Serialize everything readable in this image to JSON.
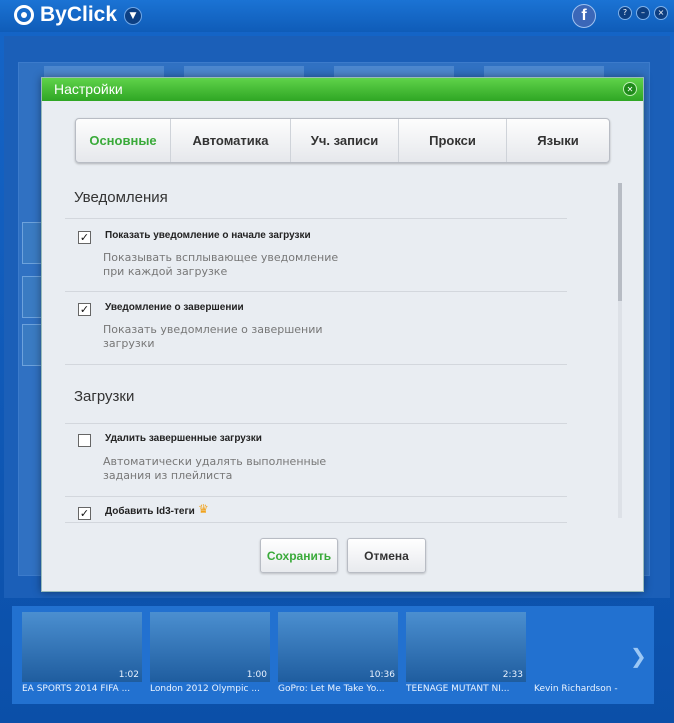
{
  "app": {
    "name": "ByClick",
    "facebook_label": "f",
    "window_buttons": [
      "?",
      "–",
      "×"
    ]
  },
  "modal": {
    "title": "Настройки",
    "tabs": [
      {
        "label": "Основные",
        "active": true
      },
      {
        "label": "Автоматика",
        "active": false
      },
      {
        "label": "Уч. записи",
        "active": false
      },
      {
        "label": "Прокси",
        "active": false
      },
      {
        "label": "Языки",
        "active": false
      }
    ],
    "sections": [
      {
        "title": "Уведомления",
        "options": [
          {
            "label": "Показать уведомление о начале загрузки",
            "checked": true,
            "desc": "Показывать всплывающее уведомление при каждой загрузке"
          },
          {
            "label": "Уведомление о завершении",
            "checked": true,
            "desc": "Показать уведомление о завершении загрузки"
          }
        ]
      },
      {
        "title": "Загрузки",
        "options": [
          {
            "label": "Удалить завершенные загрузки",
            "checked": false,
            "desc": "Автоматически удалять выполненные задания из плейлиста"
          },
          {
            "label": "Добавить Id3-теги",
            "checked": true,
            "desc": "",
            "premium": true
          }
        ]
      }
    ],
    "save_label": "Сохранить",
    "cancel_label": "Отмена"
  },
  "videos": [
    {
      "title": "EA SPORTS 2014 FIFA ...",
      "duration": "1:02"
    },
    {
      "title": "London 2012 Olympic ...",
      "duration": "1:00"
    },
    {
      "title": "GoPro: Let Me Take Yo...",
      "duration": "10:36"
    },
    {
      "title": "TEENAGE MUTANT NI...",
      "duration": "2:33"
    },
    {
      "title": "Kevin Richardson -",
      "duration": ""
    }
  ],
  "colors": {
    "accent_green": "#3aaa3a",
    "header_green": "#2fa624",
    "app_blue": "#1565c8"
  }
}
